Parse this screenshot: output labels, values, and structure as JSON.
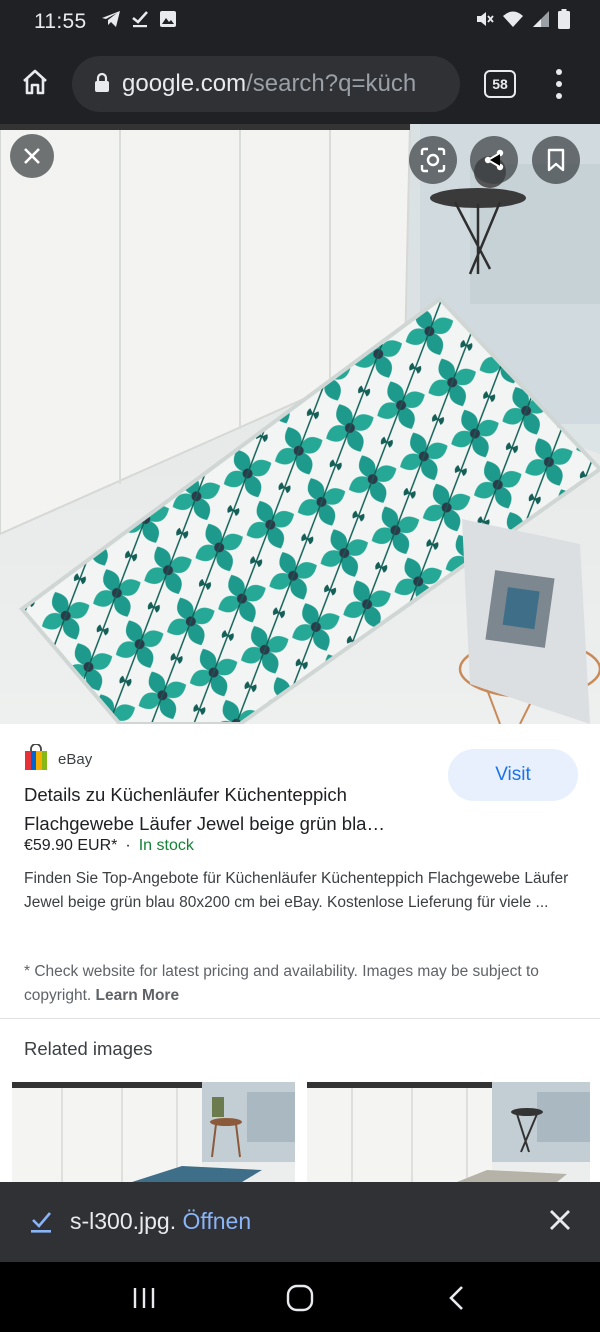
{
  "status_bar": {
    "time": "11:55",
    "left_icons": [
      "telegram-icon",
      "download-check-icon",
      "image-icon"
    ],
    "right_icons": [
      "mute-icon",
      "wifi-icon",
      "signal-icon",
      "battery-icon"
    ]
  },
  "browser": {
    "url_host": "google.com",
    "url_path": "/search?q=küch",
    "tab_count": "58"
  },
  "result": {
    "source": "eBay",
    "visit_label": "Visit",
    "title": "Details zu Küchenläufer Küchenteppich Flachgewebe Läufer Jewel beige grün bla…",
    "price": "€59.90 EUR*",
    "separator": "·",
    "stock": "In stock",
    "description": "Finden Sie Top-Angebote für Küchenläufer Küchenteppich Flachgewebe Läufer Jewel beige grün blau 80x200 cm bei eBay. Kostenlose Lieferung für viele ...",
    "disclaimer": "* Check website for latest pricing and availability. Images may be subject to copyright.",
    "learn_more": "Learn More"
  },
  "related": {
    "title": "Related images"
  },
  "download": {
    "filename": "s-l300.jpg.",
    "open_label": "Öffnen"
  },
  "colors": {
    "accent_blue": "#1a73e8",
    "in_stock_green": "#188038",
    "dark_bar": "#202124",
    "rug_teal": "#1d9a8c"
  }
}
